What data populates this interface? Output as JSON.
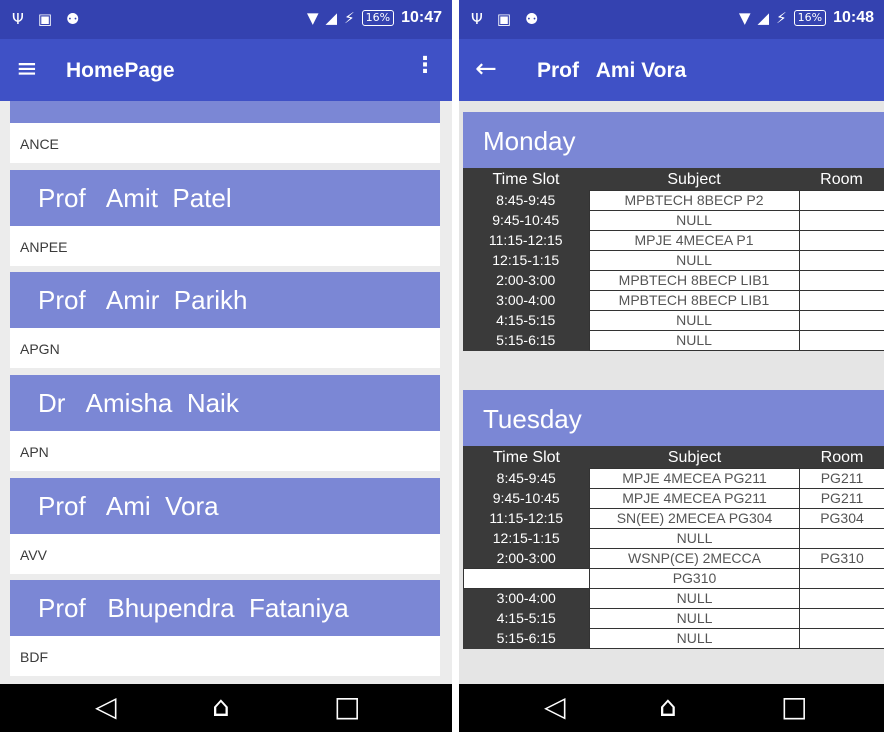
{
  "status_bar": {
    "battery": "16%"
  },
  "left_screen": {
    "status_time": "10:47",
    "app_bar": {
      "title": "HomePage"
    },
    "list": [
      {
        "name": "",
        "code": "ANCE"
      },
      {
        "name": "Prof   Amit  Patel",
        "code": "ANPEE"
      },
      {
        "name": "Prof   Amir  Parikh",
        "code": "APGN"
      },
      {
        "name": "Dr   Amisha  Naik",
        "code": "APN"
      },
      {
        "name": "Prof   Ami  Vora",
        "code": "AVV"
      },
      {
        "name": "Prof   Bhupendra  Fataniya",
        "code": "BDF"
      }
    ]
  },
  "right_screen": {
    "status_time": "10:48",
    "app_bar": {
      "title": "Prof   Ami Vora"
    },
    "columns": {
      "time": "Time Slot",
      "subject": "Subject",
      "room": "Room"
    },
    "days": [
      {
        "name": "Monday",
        "rows": [
          {
            "time": "8:45-9:45",
            "subject": "MPBTECH   8BECP P2",
            "room": ""
          },
          {
            "time": "9:45-10:45",
            "subject": "NULL",
            "room": ""
          },
          {
            "time": "11:15-12:15",
            "subject": "MPJE   4MECEA P1",
            "room": ""
          },
          {
            "time": "12:15-1:15",
            "subject": "NULL",
            "room": ""
          },
          {
            "time": "2:00-3:00",
            "subject": "MPBTECH 8BECP LIB1",
            "room": ""
          },
          {
            "time": "3:00-4:00",
            "subject": "MPBTECH 8BECP LIB1",
            "room": ""
          },
          {
            "time": "4:15-5:15",
            "subject": "NULL",
            "room": ""
          },
          {
            "time": "5:15-6:15",
            "subject": "NULL",
            "room": ""
          }
        ]
      },
      {
        "name": "Tuesday",
        "rows": [
          {
            "time": "8:45-9:45",
            "subject": "MPJE 4MECEA PG211",
            "room": "PG211"
          },
          {
            "time": "9:45-10:45",
            "subject": "MPJE 4MECEA PG211",
            "room": "PG211"
          },
          {
            "time": "11:15-12:15",
            "subject": "SN(EE)   2MECEA PG304",
            "room": "PG304"
          },
          {
            "time": "12:15-1:15",
            "subject": "NULL",
            "room": ""
          },
          {
            "time": "2:00-3:00",
            "subject": "WSNP(CE)   2MECCA",
            "room": "PG310"
          },
          {
            "time": "",
            "subject": "PG310",
            "room": ""
          },
          {
            "time": "3:00-4:00",
            "subject": "NULL",
            "room": ""
          },
          {
            "time": "4:15-5:15",
            "subject": "NULL",
            "room": ""
          },
          {
            "time": "5:15-6:15",
            "subject": "NULL",
            "room": ""
          }
        ]
      }
    ]
  }
}
